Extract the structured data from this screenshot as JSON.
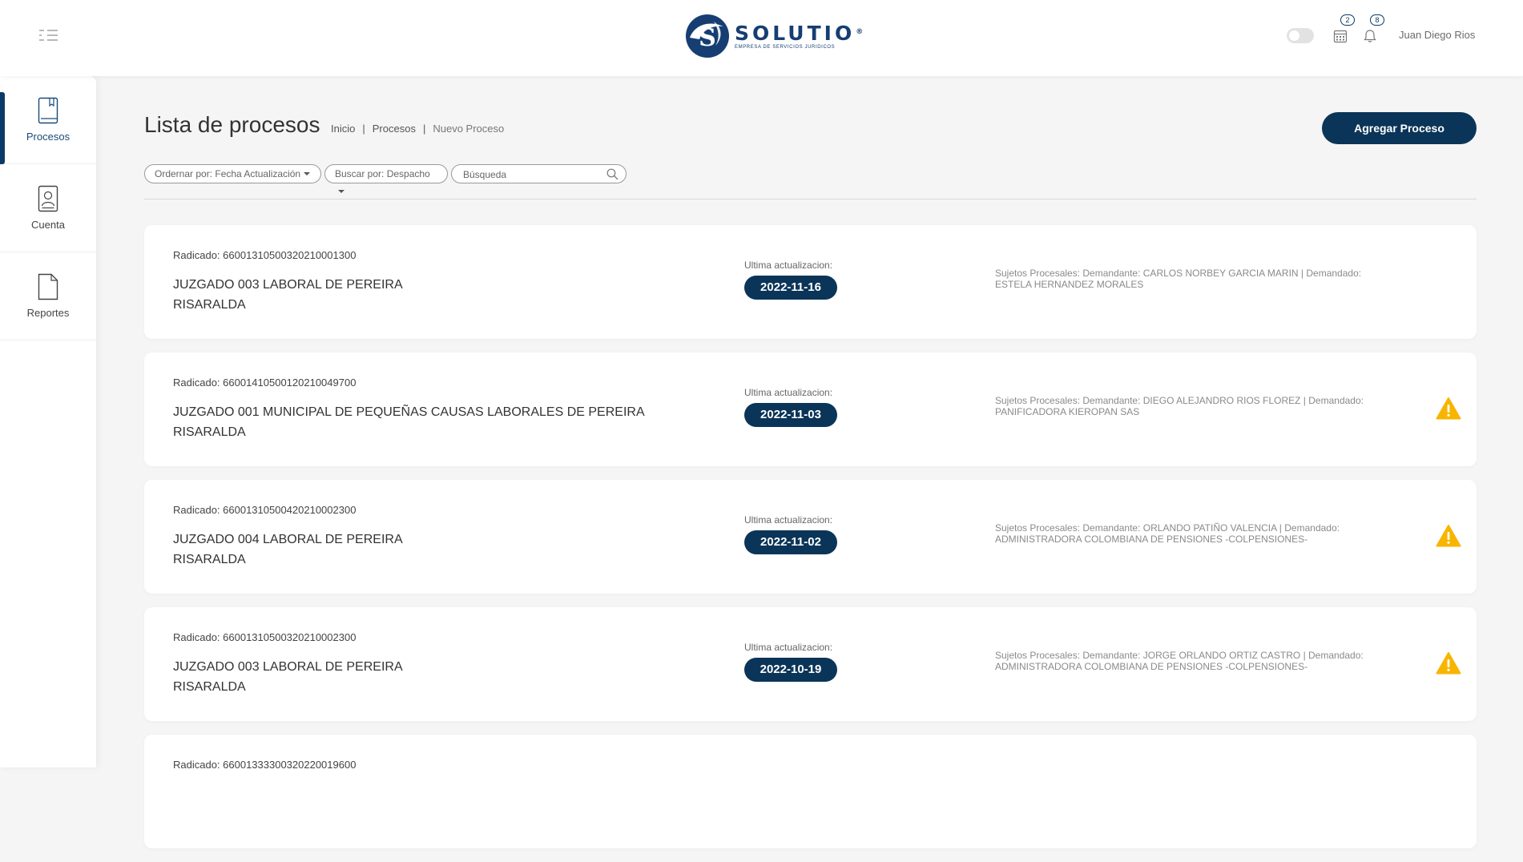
{
  "header": {
    "logo_word": "SOLUTIO",
    "logo_reg": "®",
    "logo_subtitle": "EMPRESA DE SERVICIOS JURIDICOS",
    "calendar_badge": "2",
    "notifications_badge": "8",
    "user_name": "Juan Diego Rios",
    "icons": [
      "menu-icon",
      "calendar-icon",
      "bell-icon"
    ]
  },
  "sidebar": {
    "items": [
      {
        "label": "Procesos",
        "icon": "book-icon",
        "active": true
      },
      {
        "label": "Cuenta",
        "icon": "account-card-icon",
        "active": false
      },
      {
        "label": "Reportes",
        "icon": "document-icon",
        "active": false
      }
    ]
  },
  "page": {
    "title": "Lista de procesos",
    "breadcrumb": [
      "Inicio",
      "Procesos",
      "Nuevo Proceso"
    ],
    "breadcrumb_sep": "|",
    "add_button": "Agregar Proceso"
  },
  "filters": {
    "order_by": "Ordernar por: Fecha Actualización",
    "search_by": "Buscar por: Despacho",
    "search_placeholder": "Búsqueda"
  },
  "colors": {
    "primary": "#0b3558",
    "warning": "#f7b500"
  },
  "processes": [
    {
      "radicado": "Radicado: 66001310500320210001300",
      "court_line1": "JUZGADO 003 LABORAL DE PEREIRA",
      "court_line2": "RISARALDA",
      "update_label": "Ultima actualizacion:",
      "update_date": "2022-11-16",
      "sujetos_line1": "Sujetos Procesales: Demandante: CARLOS NORBEY GARCIA MARIN | Demandado:",
      "sujetos_line2": "ESTELA HERNANDEZ MORALES",
      "warning": false
    },
    {
      "radicado": "Radicado: 66001410500120210049700",
      "court_line1": "JUZGADO 001 MUNICIPAL DE PEQUEÑAS CAUSAS LABORALES DE PEREIRA",
      "court_line2": "RISARALDA",
      "update_label": "Ultima actualizacion:",
      "update_date": "2022-11-03",
      "sujetos_line1": "Sujetos Procesales: Demandante: DIEGO ALEJANDRO RIOS FLOREZ | Demandado:",
      "sujetos_line2": "PANIFICADORA KIEROPAN SAS",
      "warning": true
    },
    {
      "radicado": "Radicado: 66001310500420210002300",
      "court_line1": "JUZGADO 004 LABORAL DE PEREIRA",
      "court_line2": "RISARALDA",
      "update_label": "Ultima actualizacion:",
      "update_date": "2022-11-02",
      "sujetos_line1": "Sujetos Procesales: Demandante: ORLANDO PATIÑO VALENCIA | Demandado:",
      "sujetos_line2": "ADMINISTRADORA COLOMBIANA DE PENSIONES -COLPENSIONES-",
      "warning": true
    },
    {
      "radicado": "Radicado: 66001310500320210002300",
      "court_line1": "JUZGADO 003 LABORAL DE PEREIRA",
      "court_line2": "RISARALDA",
      "update_label": "Ultima actualizacion:",
      "update_date": "2022-10-19",
      "sujetos_line1": "Sujetos Procesales: Demandante: JORGE ORLANDO ORTIZ CASTRO | Demandado:",
      "sujetos_line2": "ADMINISTRADORA COLOMBIANA DE PENSIONES -COLPENSIONES-",
      "warning": true
    },
    {
      "radicado": "Radicado: 66001333300320220019600",
      "court_line1": "",
      "court_line2": "",
      "update_label": "",
      "update_date": "",
      "sujetos_line1": "",
      "sujetos_line2": "",
      "warning": false
    }
  ]
}
